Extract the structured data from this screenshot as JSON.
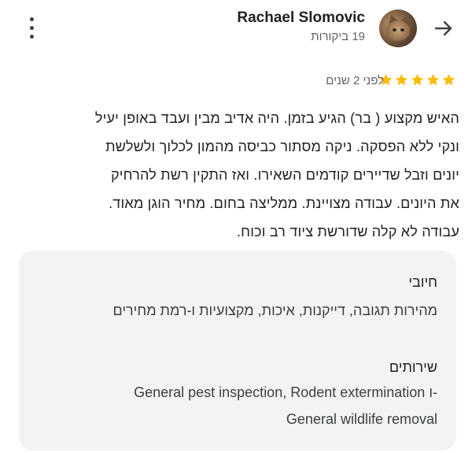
{
  "reviewer": {
    "name": "Rachael Slomovic",
    "review_count": "19 ביקורות"
  },
  "review": {
    "rating": 5,
    "max_rating": 5,
    "time_ago": "לפני 2 שנים",
    "text_lines": [
      "האיש מקצוע ( בר) הגיע בזמן. היה אדיב מבין ועבד באופן יעיל",
      "ונקי ללא הפסקה. ניקה מסתור כביסה מהמון לכלוך ולשלשת",
      "יונים וזבל שדיירים קודמים השאירו. ואז התקין רשת להרחיק",
      "את היונים. עבודה מצויינת. ממליצה בחום. מחיר הוגן מאוד.",
      "עבודה לא קלה שדורשת ציוד רב וכוח."
    ]
  },
  "details": {
    "positives_label": "חיובי",
    "positives_value": "מהירות תגובה, דייקנות, איכות, מקצועיות ו-רמת מחירים",
    "services_label": "שירותים",
    "services_line1": "General pest inspection, Rodent extermination ו-",
    "services_line2": "General wildlife removal"
  },
  "colors": {
    "star": "#fbbc04",
    "panel": "#f1f3f4",
    "secondary_text": "#5f6368"
  },
  "icons": {
    "back": "arrow-right-icon",
    "menu": "more-vertical-icon",
    "star": "star-icon"
  }
}
